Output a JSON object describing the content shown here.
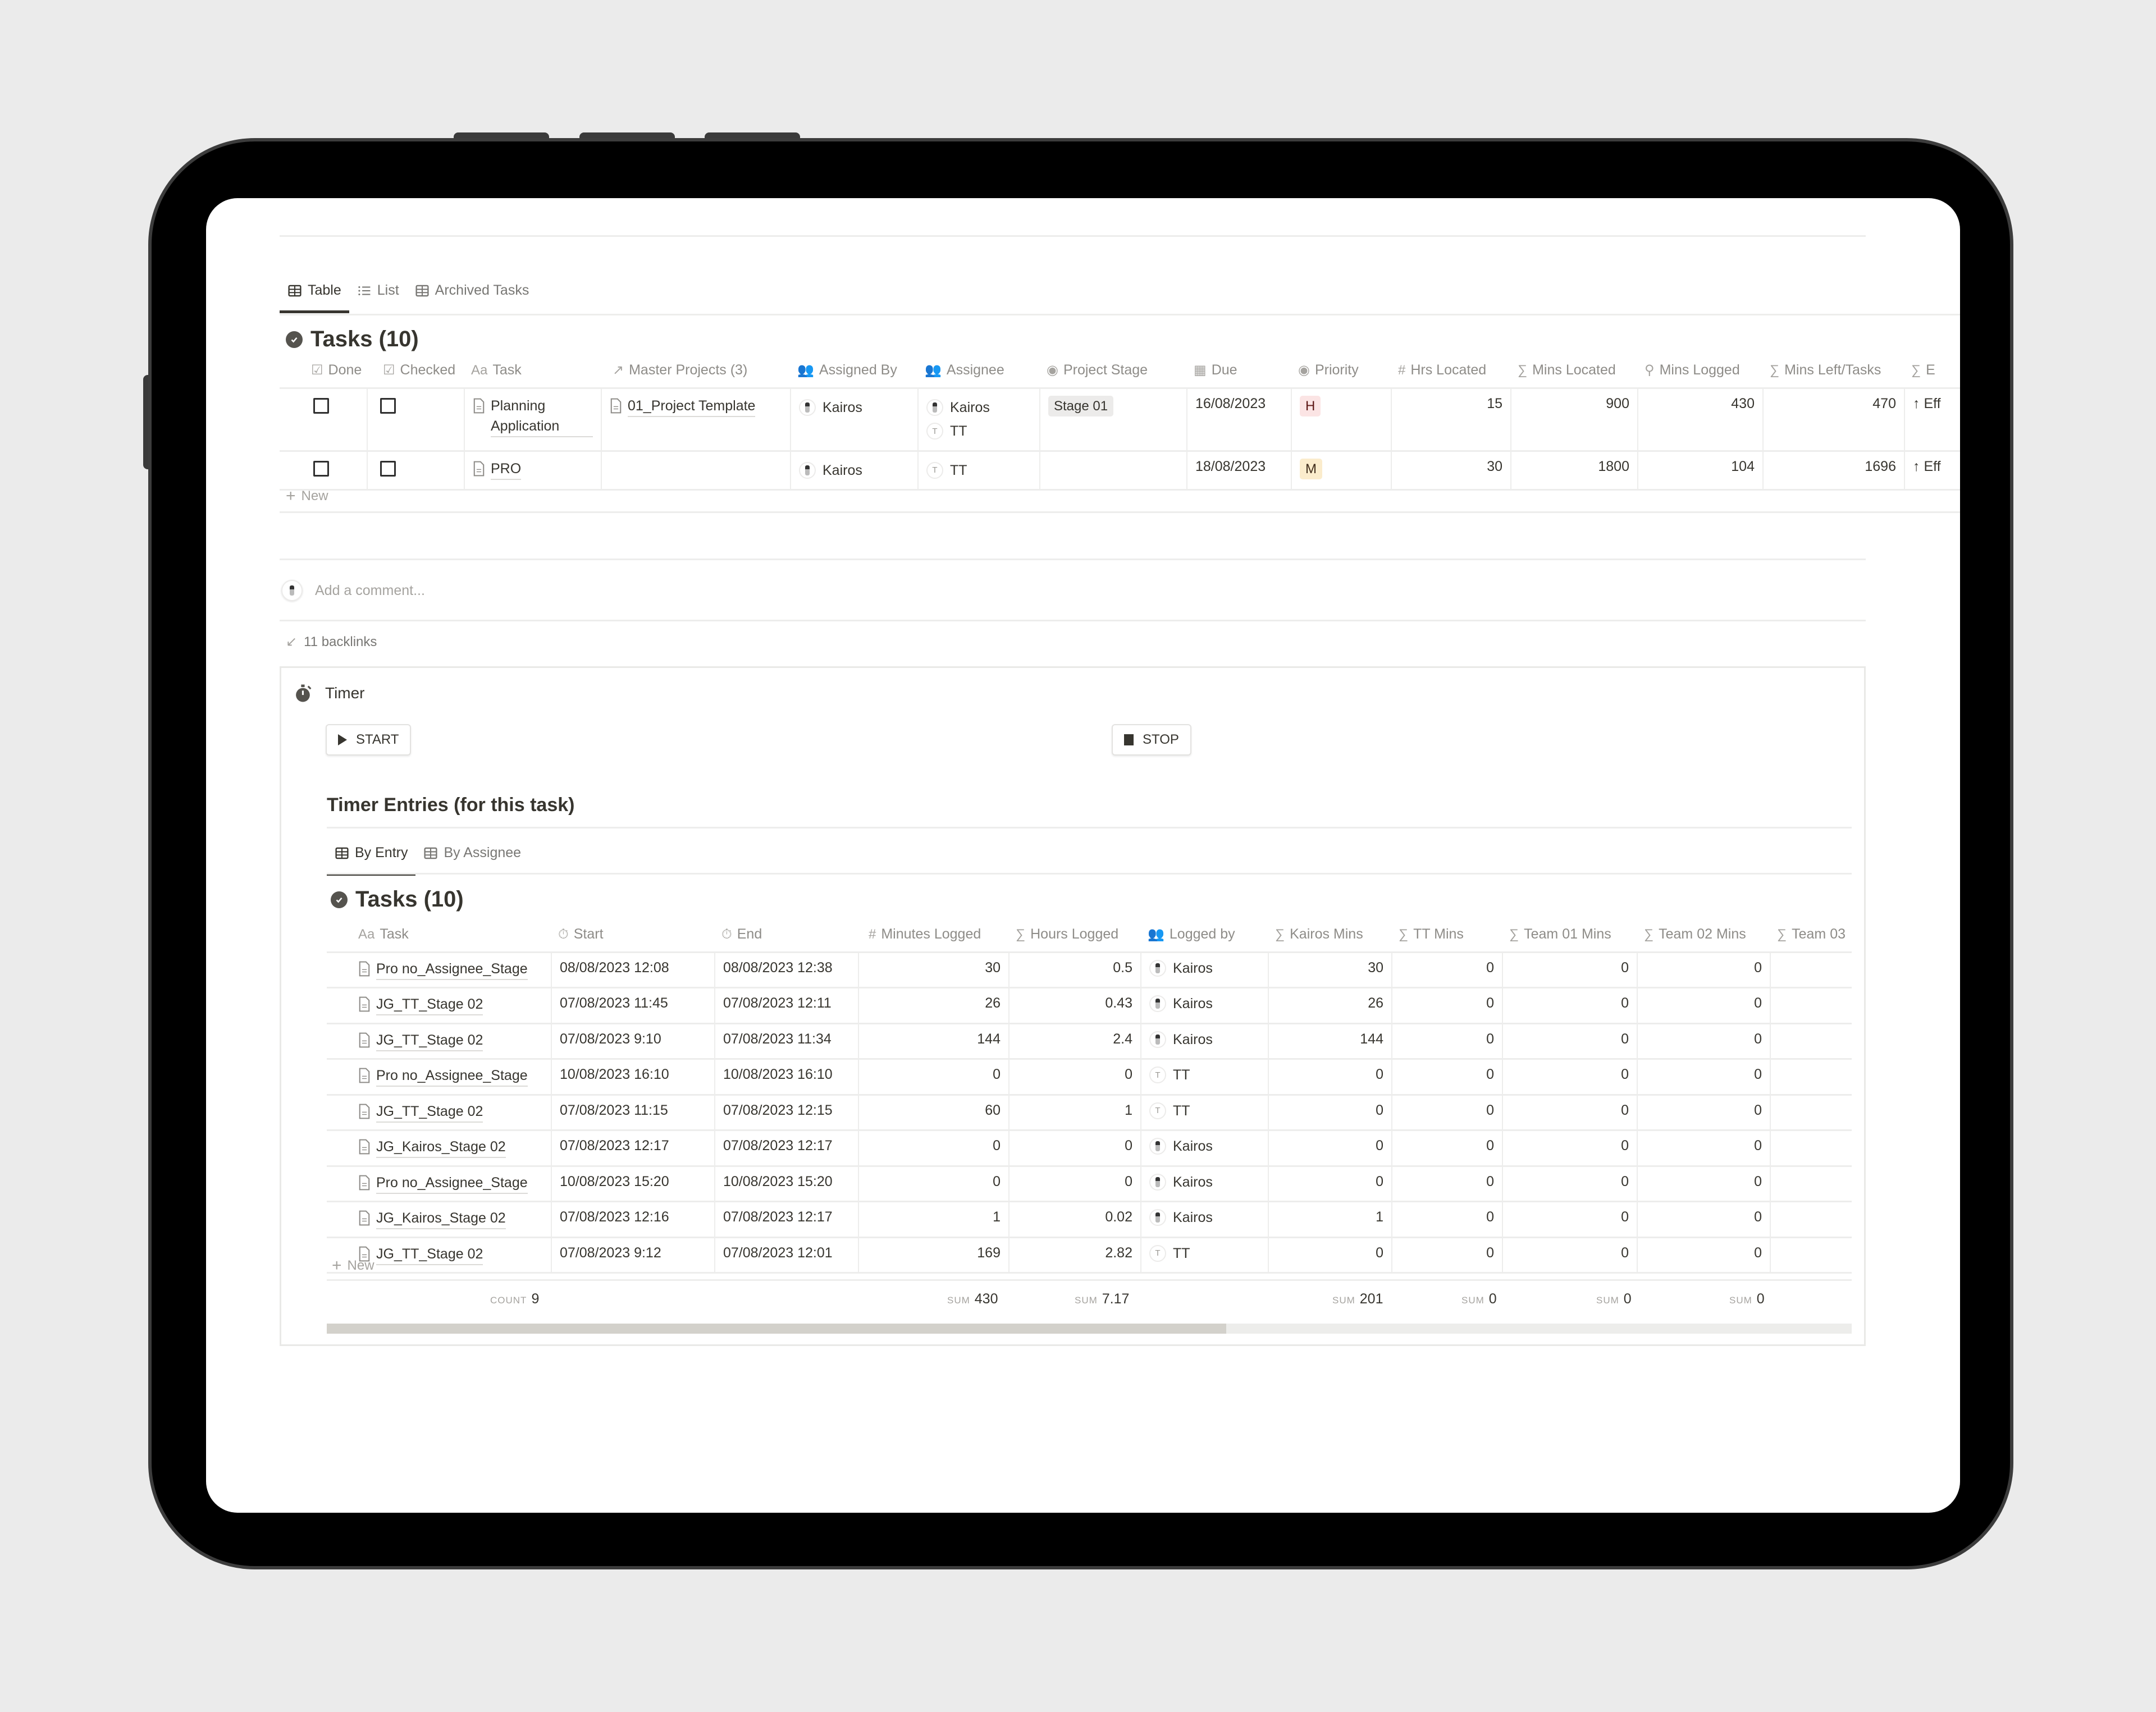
{
  "view_tabs": [
    {
      "label": "Table",
      "icon": "table-icon",
      "active": true
    },
    {
      "label": "List",
      "icon": "list-icon",
      "active": false
    },
    {
      "label": "Archived Tasks",
      "icon": "table-icon",
      "active": false
    }
  ],
  "tasks_db": {
    "title": "Tasks (10)",
    "columns": [
      {
        "label": "Done",
        "icon": "checkbox-icon"
      },
      {
        "label": "Checked",
        "icon": "checkbox-icon"
      },
      {
        "label": "Task",
        "icon": "text-icon"
      },
      {
        "label": "Master Projects (3)",
        "icon": "relation-arrow-icon"
      },
      {
        "label": "Assigned By",
        "icon": "people-icon"
      },
      {
        "label": "Assignee",
        "icon": "people-icon"
      },
      {
        "label": "Project Stage",
        "icon": "select-icon"
      },
      {
        "label": "Due",
        "icon": "calendar-icon"
      },
      {
        "label": "Priority",
        "icon": "select-icon"
      },
      {
        "label": "Hrs Located",
        "icon": "number-icon"
      },
      {
        "label": "Mins Located",
        "icon": "formula-icon"
      },
      {
        "label": "Mins Logged",
        "icon": "rollup-icon"
      },
      {
        "label": "Mins Left/Tasks",
        "icon": "formula-icon"
      },
      {
        "label": "E",
        "icon": "formula-icon"
      }
    ],
    "rows": [
      {
        "done": false,
        "checked": false,
        "task": "Planning Application",
        "master_project": "01_Project Template",
        "assigned_by": "Kairos",
        "assignee": [
          "Kairos",
          "TT"
        ],
        "project_stage": "Stage 01",
        "due": "16/08/2023",
        "priority": "H",
        "hrs_located": "15",
        "mins_located": "900",
        "mins_logged": "430",
        "mins_left": "470",
        "extra": "↑ Eff"
      },
      {
        "done": false,
        "checked": false,
        "task": "PRO",
        "master_project": "",
        "assigned_by": "Kairos",
        "assignee": [
          "TT"
        ],
        "project_stage": "",
        "due": "18/08/2023",
        "priority": "M",
        "hrs_located": "30",
        "mins_located": "1800",
        "mins_logged": "104",
        "mins_left": "1696",
        "extra": "↑ Eff"
      }
    ],
    "new_label": "New",
    "priority_colors": {
      "H": {
        "bg": "#fbe4e4",
        "fg": "#5d1715"
      },
      "M": {
        "bg": "#fbeccc",
        "fg": "#402c1b"
      }
    },
    "stage_tag_bg": "#ecebea"
  },
  "comment": {
    "placeholder": "Add a comment..."
  },
  "backlinks": {
    "label": "11 backlinks"
  },
  "timer": {
    "title": "Timer",
    "start_label": "START",
    "stop_label": "STOP",
    "entries_heading": "Timer Entries (for this task)",
    "tabs": [
      {
        "label": "By Entry",
        "active": true
      },
      {
        "label": "By Assignee",
        "active": false
      }
    ],
    "db_title": "Tasks (10)",
    "columns": [
      {
        "label": "Task",
        "icon": "text-icon"
      },
      {
        "label": "Start",
        "icon": "stopwatch-icon"
      },
      {
        "label": "End",
        "icon": "stopwatch-icon"
      },
      {
        "label": "Minutes Logged",
        "icon": "number-icon"
      },
      {
        "label": "Hours Logged",
        "icon": "formula-icon"
      },
      {
        "label": "Logged by",
        "icon": "people-icon"
      },
      {
        "label": "Kairos Mins",
        "icon": "formula-icon"
      },
      {
        "label": "TT Mins",
        "icon": "formula-icon"
      },
      {
        "label": "Team 01 Mins",
        "icon": "formula-icon"
      },
      {
        "label": "Team 02 Mins",
        "icon": "formula-icon"
      },
      {
        "label": "Team 03",
        "icon": "formula-icon"
      }
    ],
    "rows": [
      {
        "task": "Pro no_Assignee_Stage",
        "start": "08/08/2023 12:08",
        "end": "08/08/2023 12:38",
        "minutes": "30",
        "hours": "0.5",
        "logged_by": "Kairos",
        "kairos": "30",
        "tt": "0",
        "team01": "0",
        "team02": "0"
      },
      {
        "task": "JG_TT_Stage 02",
        "start": "07/08/2023 11:45",
        "end": "07/08/2023 12:11",
        "minutes": "26",
        "hours": "0.43",
        "logged_by": "Kairos",
        "kairos": "26",
        "tt": "0",
        "team01": "0",
        "team02": "0"
      },
      {
        "task": "JG_TT_Stage 02",
        "start": "07/08/2023 9:10",
        "end": "07/08/2023 11:34",
        "minutes": "144",
        "hours": "2.4",
        "logged_by": "Kairos",
        "kairos": "144",
        "tt": "0",
        "team01": "0",
        "team02": "0"
      },
      {
        "task": "Pro no_Assignee_Stage",
        "start": "10/08/2023 16:10",
        "end": "10/08/2023 16:10",
        "minutes": "0",
        "hours": "0",
        "logged_by": "TT",
        "kairos": "0",
        "tt": "0",
        "team01": "0",
        "team02": "0"
      },
      {
        "task": "JG_TT_Stage 02",
        "start": "07/08/2023 11:15",
        "end": "07/08/2023 12:15",
        "minutes": "60",
        "hours": "1",
        "logged_by": "TT",
        "kairos": "0",
        "tt": "0",
        "team01": "0",
        "team02": "0"
      },
      {
        "task": "JG_Kairos_Stage 02",
        "start": "07/08/2023 12:17",
        "end": "07/08/2023 12:17",
        "minutes": "0",
        "hours": "0",
        "logged_by": "Kairos",
        "kairos": "0",
        "tt": "0",
        "team01": "0",
        "team02": "0"
      },
      {
        "task": "Pro no_Assignee_Stage",
        "start": "10/08/2023 15:20",
        "end": "10/08/2023 15:20",
        "minutes": "0",
        "hours": "0",
        "logged_by": "Kairos",
        "kairos": "0",
        "tt": "0",
        "team01": "0",
        "team02": "0"
      },
      {
        "task": "JG_Kairos_Stage 02",
        "start": "07/08/2023 12:16",
        "end": "07/08/2023 12:17",
        "minutes": "1",
        "hours": "0.02",
        "logged_by": "Kairos",
        "kairos": "1",
        "tt": "0",
        "team01": "0",
        "team02": "0"
      },
      {
        "task": "JG_TT_Stage 02",
        "start": "07/08/2023 9:12",
        "end": "07/08/2023 12:01",
        "minutes": "169",
        "hours": "2.82",
        "logged_by": "TT",
        "kairos": "0",
        "tt": "0",
        "team01": "0",
        "team02": "0"
      }
    ],
    "new_label": "New",
    "footer": {
      "count": {
        "label": "COUNT",
        "value": "9"
      },
      "minutes_sum": {
        "label": "SUM",
        "value": "430"
      },
      "hours_sum": {
        "label": "SUM",
        "value": "7.17"
      },
      "kairos_sum": {
        "label": "SUM",
        "value": "201"
      },
      "tt_sum": {
        "label": "SUM",
        "value": "0"
      },
      "team01_sum": {
        "label": "SUM",
        "value": "0"
      },
      "team02_sum": {
        "label": "SUM",
        "value": "0"
      }
    },
    "scroll_position_fraction": 0.59
  }
}
